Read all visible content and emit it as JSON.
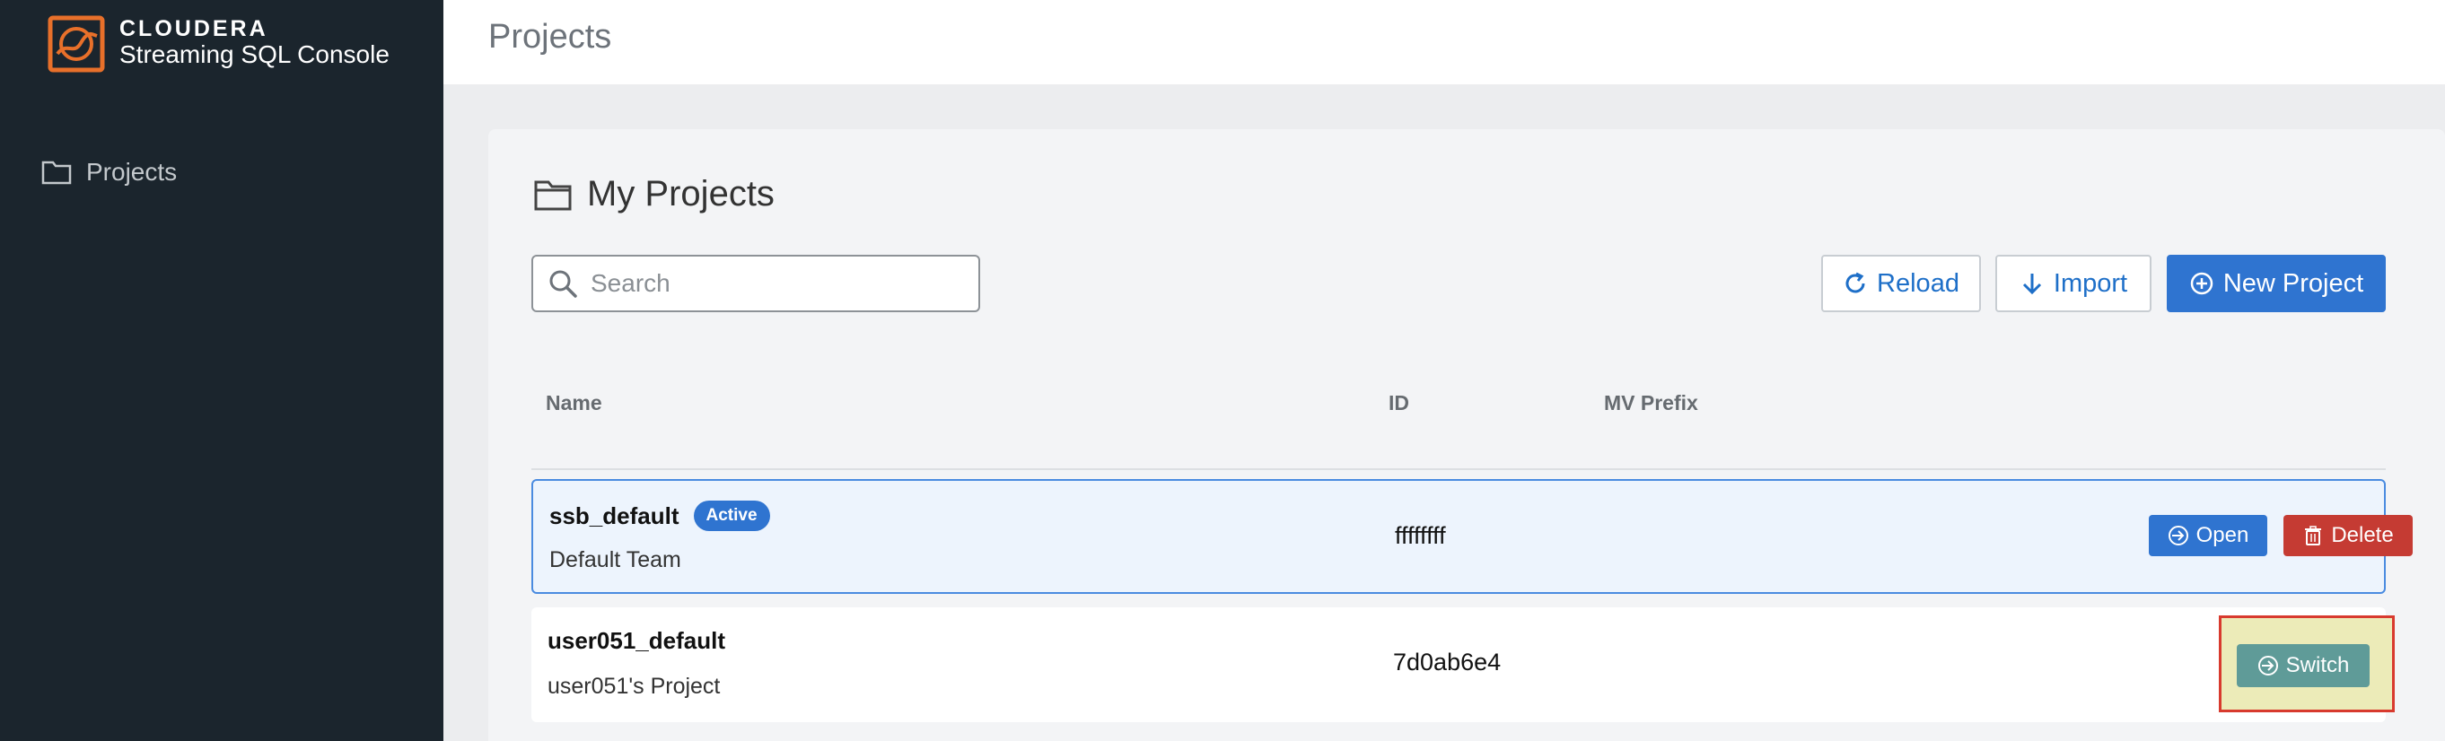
{
  "sidebar": {
    "brand_title": "CLOUDERA",
    "brand_subtitle": "Streaming SQL Console",
    "items": [
      {
        "label": "Projects",
        "icon": "folder-icon"
      }
    ]
  },
  "header": {
    "title": "Projects"
  },
  "main": {
    "heading": "My Projects",
    "search": {
      "placeholder": "Search",
      "value": ""
    },
    "toolbar": {
      "reload_label": "Reload",
      "import_label": "Import",
      "new_project_label": "New Project"
    },
    "table": {
      "columns": [
        "Name",
        "ID",
        "MV Prefix"
      ],
      "rows": [
        {
          "name": "ssb_default",
          "badge": "Active",
          "description": "Default Team",
          "id": "ffffffff",
          "mv_prefix": "",
          "actions": [
            "Open",
            "Delete"
          ]
        },
        {
          "name": "user051_default",
          "badge": "",
          "description": "user051's Project",
          "id": "7d0ab6e4",
          "mv_prefix": "",
          "actions": [
            "Switch"
          ]
        }
      ]
    }
  },
  "colors": {
    "sidebar_bg": "#1b252d",
    "accent": "#2f74d0",
    "danger": "#c53b33",
    "switch": "#5f9b98",
    "logo": "#e8702a"
  }
}
